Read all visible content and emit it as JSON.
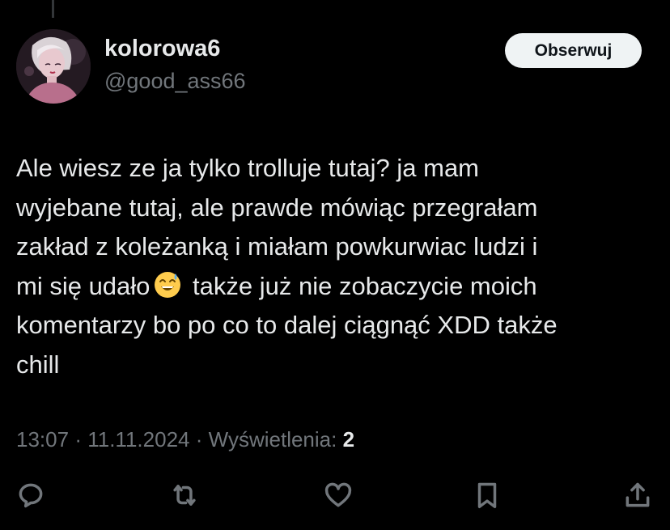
{
  "tweet": {
    "author": {
      "display_name": "kolorowa6",
      "handle": "@good_ass66",
      "avatar_icon": "avatar-illustration"
    },
    "follow_label": "Obserwuj",
    "body_lines": [
      "Ale wiesz ze ja tylko trolluje tutaj? ja mam",
      "wyjebane tutaj, ale prawde mówiąc przegrałam",
      "zakład z koleżanką i miałam powkurwiac ludzi i",
      "mi się udało",
      " także już nie zobaczycie moich",
      "komentarzy bo po co to dalej ciągnąć XDD także",
      "chill"
    ],
    "emoji": "grinning-face-with-sweat-emoji",
    "time": "13:07",
    "separator": "·",
    "date": "11.11.2024",
    "views_label": "Wyświetlenia:",
    "views_count": "2"
  },
  "actions": [
    {
      "name": "reply-icon"
    },
    {
      "name": "retweet-icon"
    },
    {
      "name": "like-icon"
    },
    {
      "name": "bookmark-icon"
    },
    {
      "name": "share-icon"
    }
  ],
  "colors": {
    "background": "#000000",
    "text": "#e7e9ea",
    "secondary_text": "#71767b",
    "button_bg": "#eff3f4"
  }
}
